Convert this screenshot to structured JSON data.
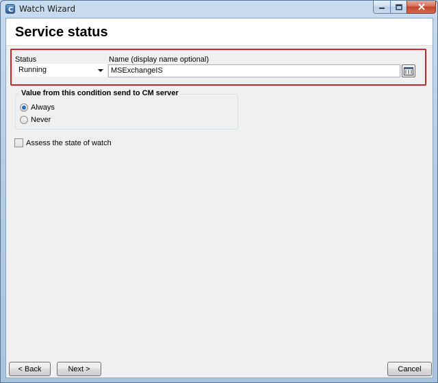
{
  "window": {
    "title": "Watch Wizard",
    "buttons": {
      "minimize": "minimize-icon",
      "maximize": "maximize-icon",
      "close": "close-icon"
    }
  },
  "page": {
    "title": "Service status"
  },
  "form": {
    "status_label": "Status",
    "status_value": "Running",
    "name_label": "Name (display name optional)",
    "name_value": "MSExchangeIS"
  },
  "send_group": {
    "title": "Value from this condition send to CM server",
    "options": [
      {
        "label": "Always",
        "selected": true
      },
      {
        "label": "Never",
        "selected": false
      }
    ]
  },
  "assess": {
    "label": "Assess the state of watch",
    "checked": false
  },
  "nav": {
    "back": "< Back",
    "next": "Next >",
    "cancel": "Cancel"
  },
  "colors": {
    "highlight_border": "#c8262f",
    "radio_dot": "#2b6fb8"
  }
}
